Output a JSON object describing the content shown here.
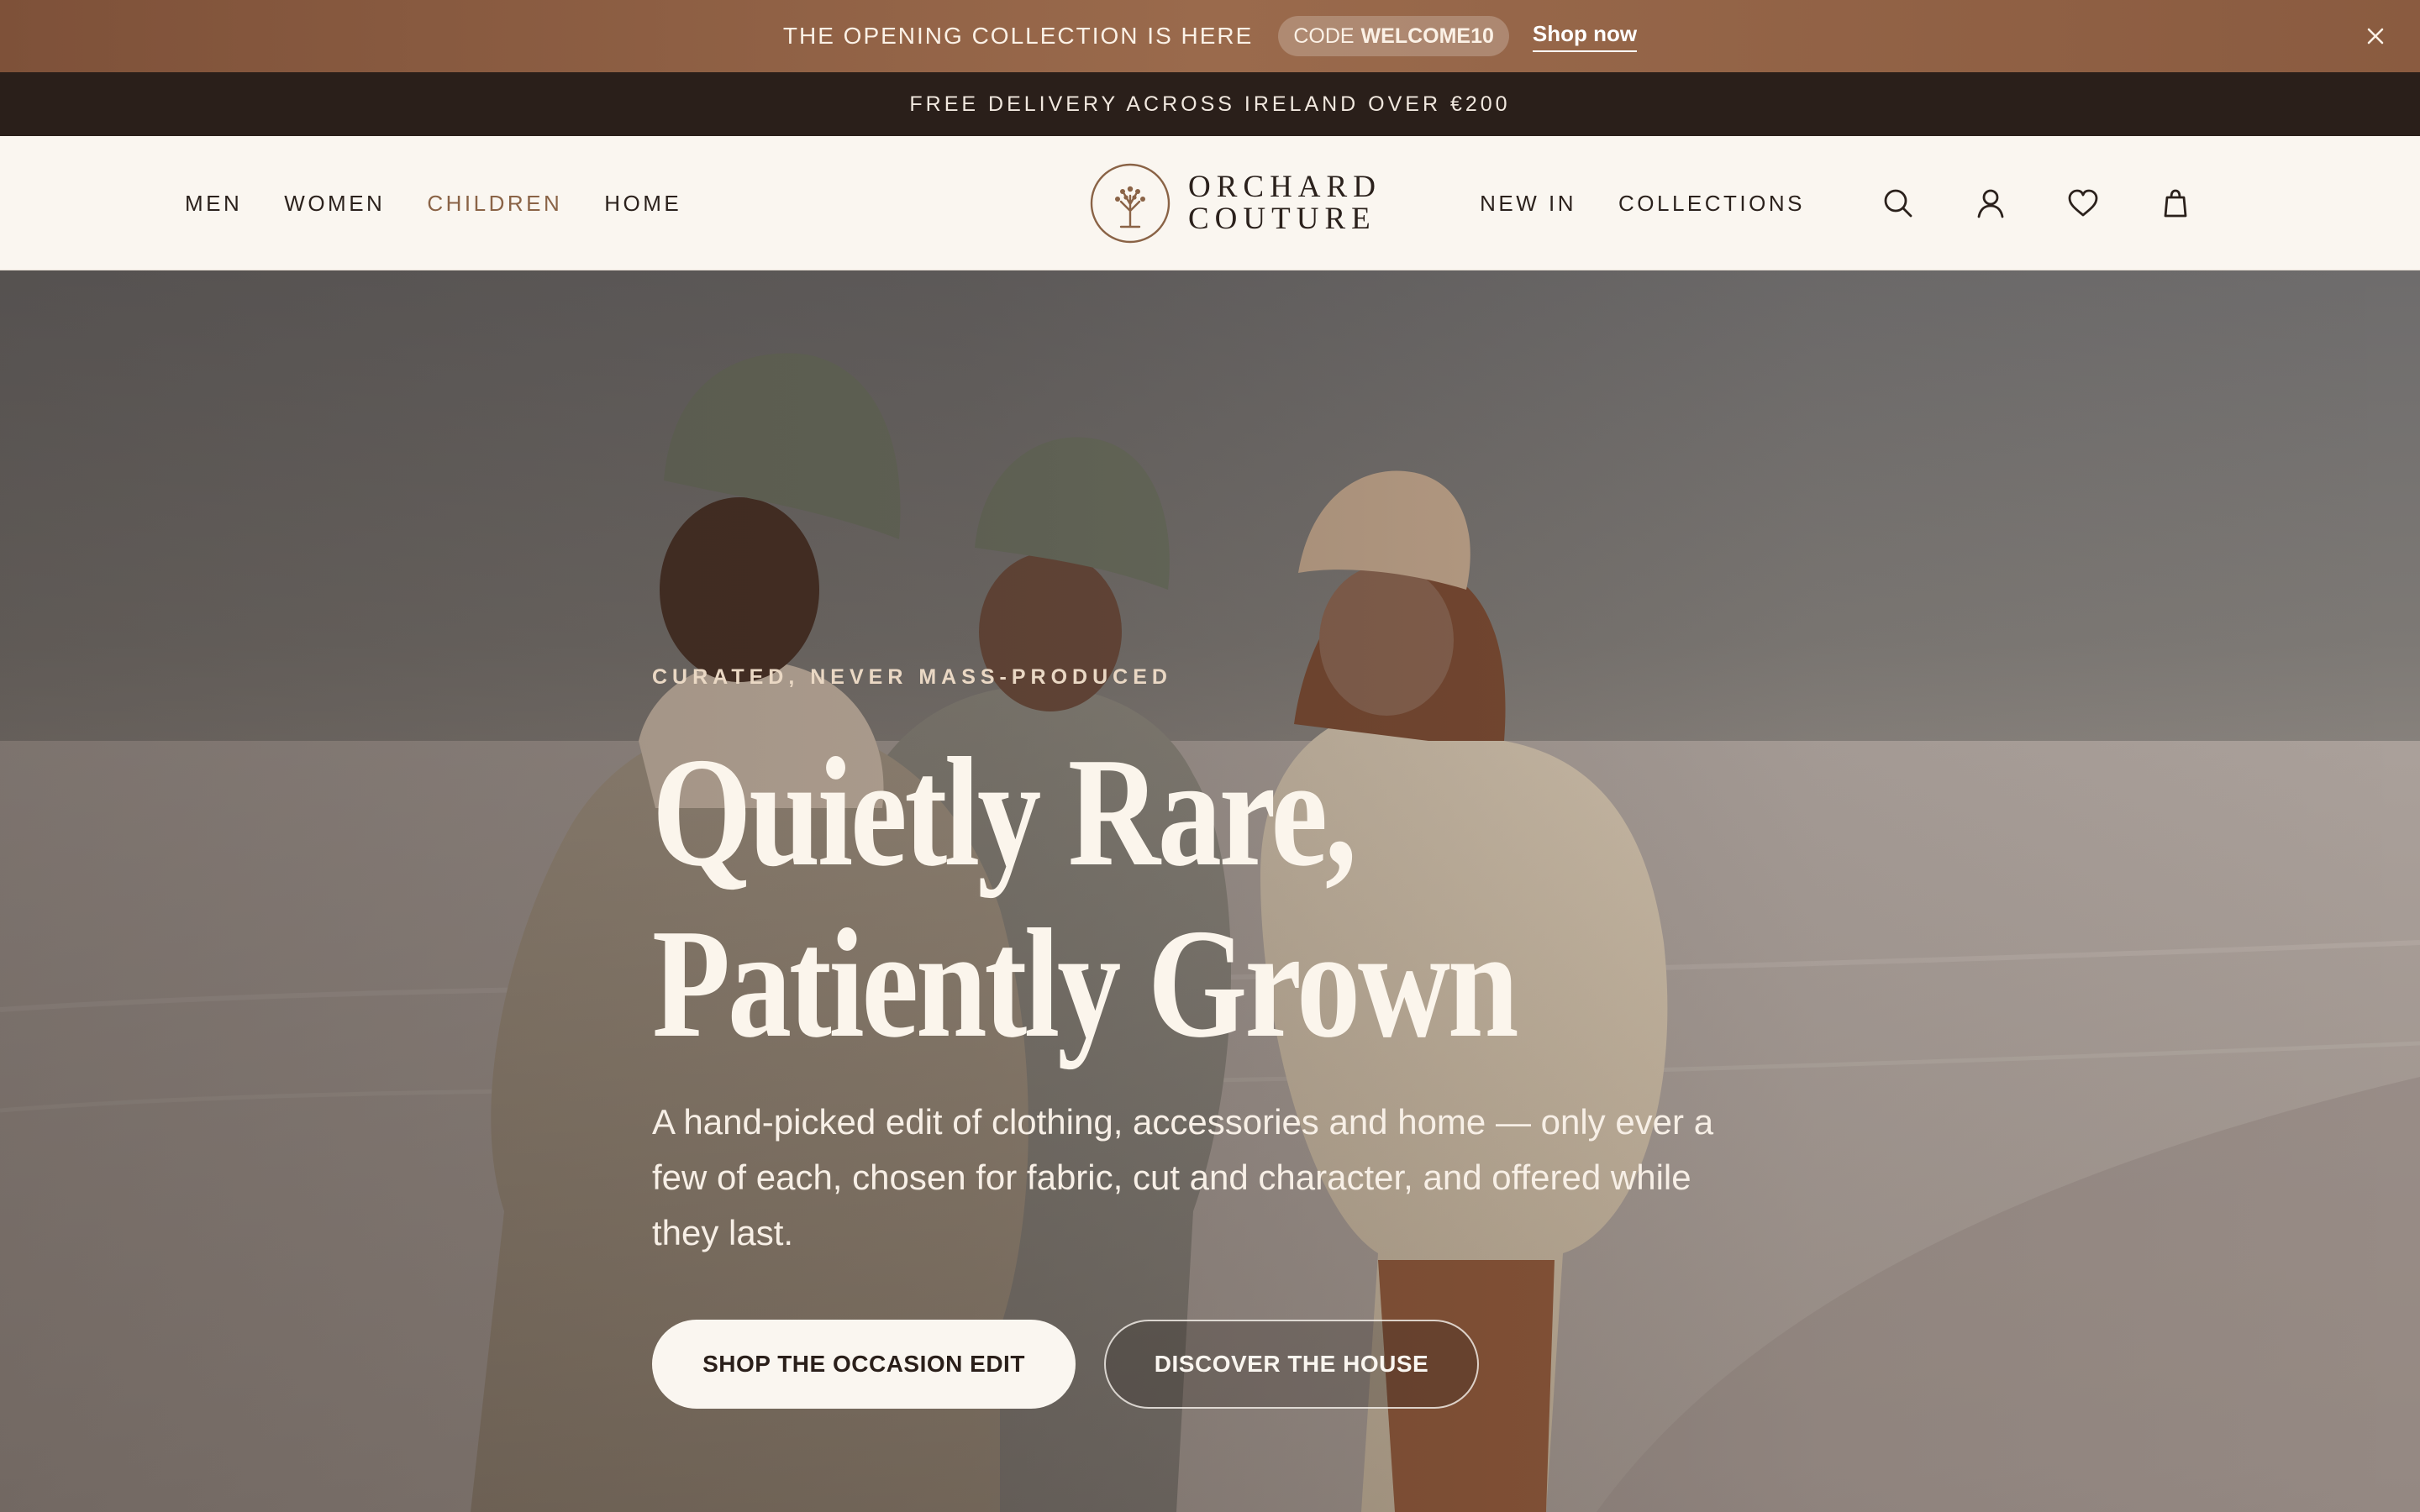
{
  "promo": {
    "message": "THE OPENING COLLECTION IS HERE",
    "code_label": "CODE",
    "code_value": "WELCOME10",
    "cta": "Shop now"
  },
  "delivery": {
    "message": "FREE DELIVERY ACROSS IRELAND OVER €200"
  },
  "nav": {
    "left": [
      {
        "label": "MEN"
      },
      {
        "label": "WOMEN"
      },
      {
        "label": "CHILDREN"
      },
      {
        "label": "HOME"
      }
    ],
    "active": "CHILDREN",
    "right": [
      {
        "label": "NEW IN"
      },
      {
        "label": "COLLECTIONS"
      }
    ],
    "icons": [
      "search-icon",
      "account-icon",
      "wishlist-icon",
      "bag-icon"
    ]
  },
  "brand": {
    "line1": "ORCHARD",
    "line2": "COUTURE",
    "accent": "#8a6346"
  },
  "hero": {
    "eyebrow": "CURATED, NEVER MASS-PRODUCED",
    "headline_line1": "Quietly Rare,",
    "headline_line2": "Patiently Grown",
    "subtext": "A hand-picked edit of clothing, accessories and home — only ever a few of each, chosen for fabric, cut and character, and offered while they last.",
    "primary_cta": "SHOP THE OCCASION EDIT",
    "secondary_cta": "DISCOVER THE HOUSE"
  },
  "colors": {
    "promo_bg": "#8a5b40",
    "delivery_bg": "#2a1f1a",
    "header_bg": "#faf6f0"
  }
}
